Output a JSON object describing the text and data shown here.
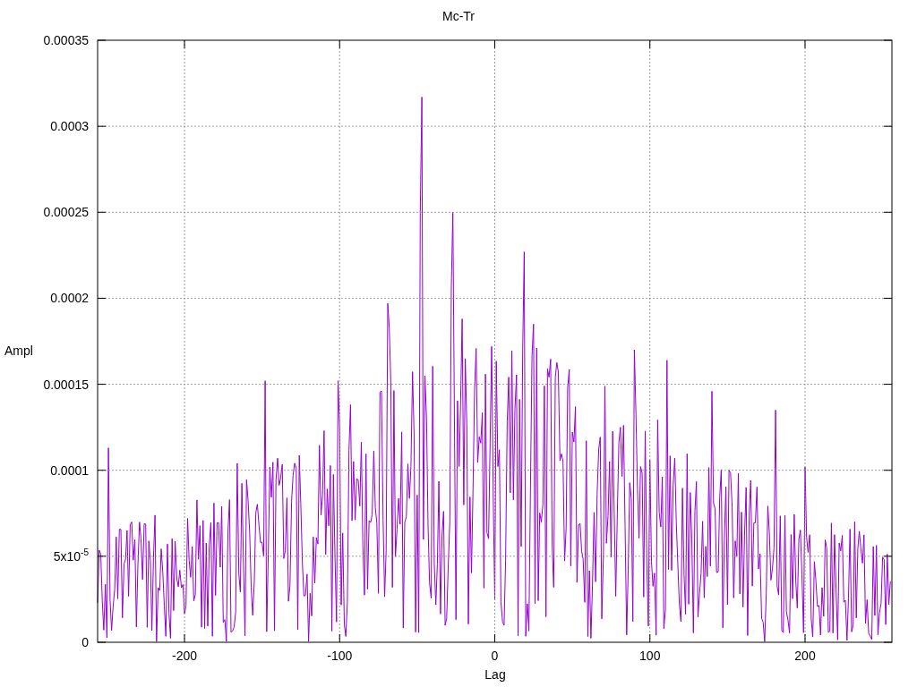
{
  "plot": {
    "chart_data": {
      "type": "line",
      "grid": true,
      "title": "Mc-Tr",
      "xlabel": "Lag",
      "ylabel": "Ampl",
      "xlim": [
        -256,
        256
      ],
      "ylim": [
        0,
        0.00035
      ],
      "xticks": [
        -200,
        -100,
        0,
        100,
        200
      ],
      "yticks": [
        0,
        {
          "value": 5e-05,
          "label": "5x10$^{-5}$"
        },
        0.0001,
        0.00015,
        0.0002,
        0.00025,
        0.0003,
        0.00035
      ]
    }
  }
}
